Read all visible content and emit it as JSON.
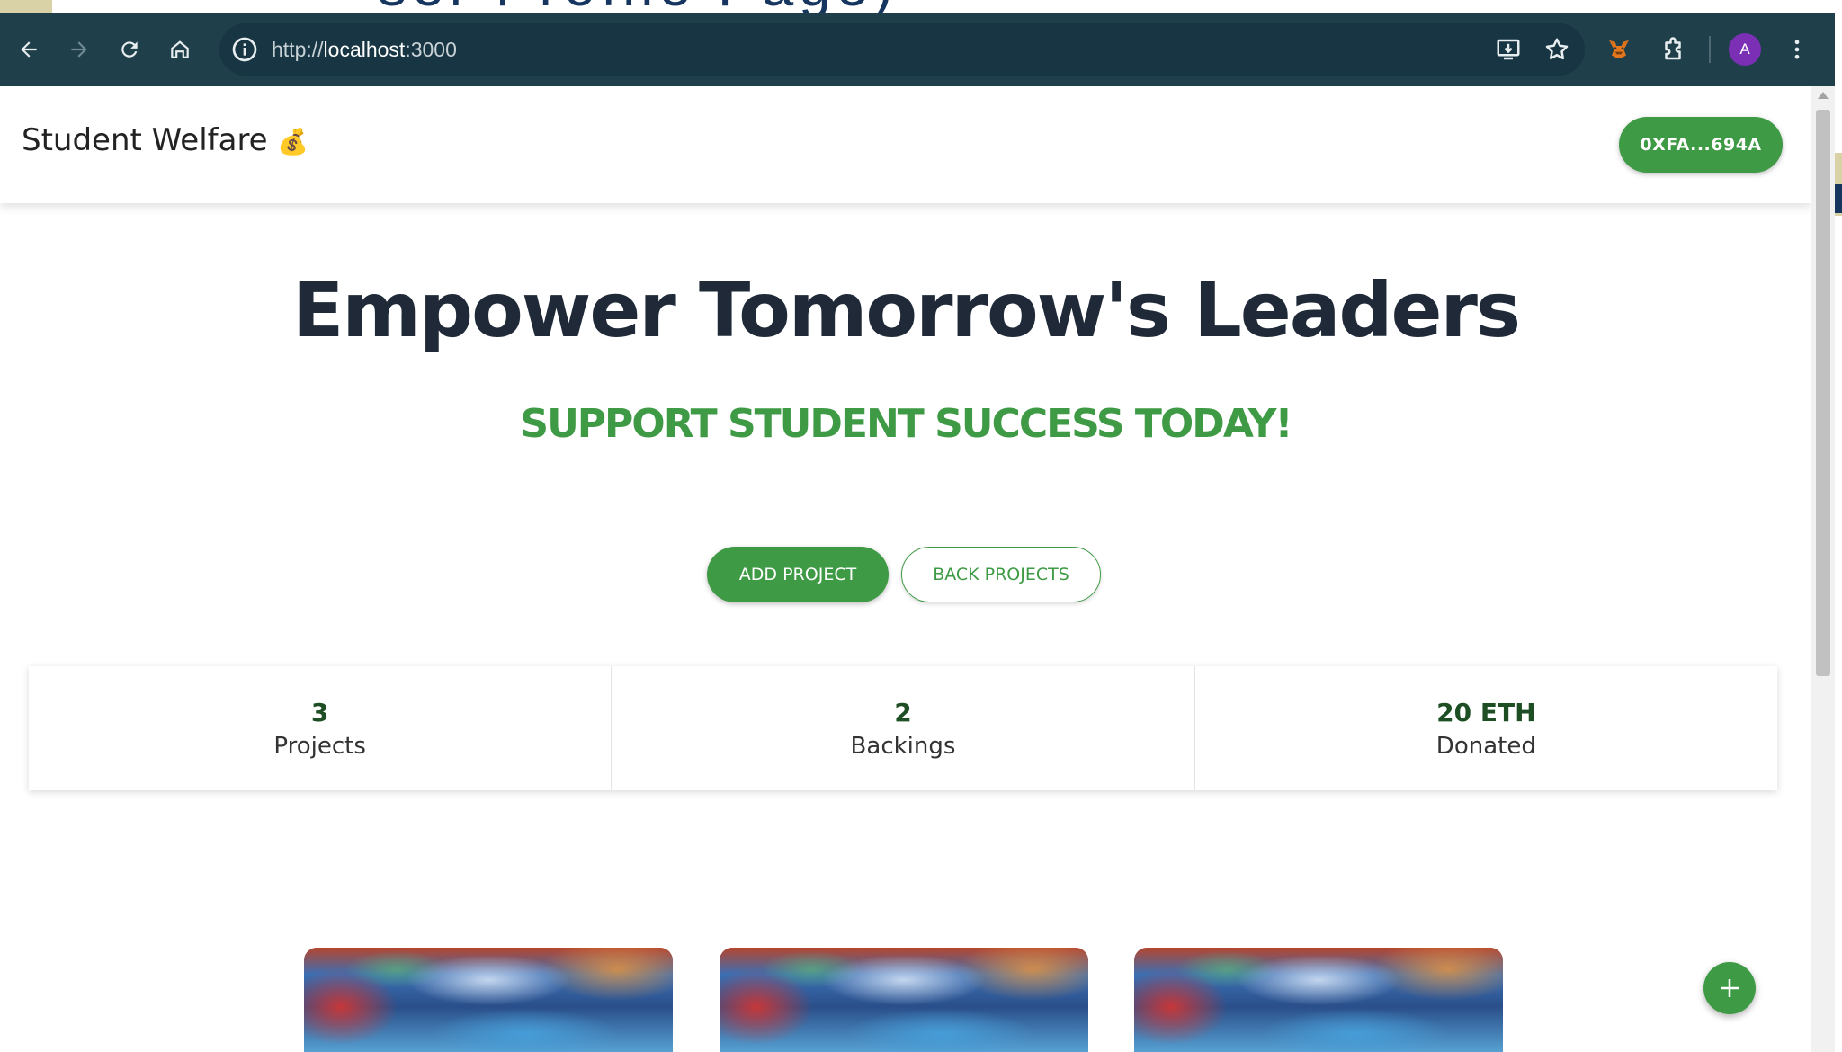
{
  "slide": {
    "title_fragment": "ser Profile Page)"
  },
  "browser": {
    "url_prefix": "http://",
    "url_host": "localhost",
    "url_port": ":3000",
    "avatar_letter": "A",
    "icons": [
      "back-icon",
      "forward-icon",
      "reload-icon",
      "home-icon",
      "site-info-icon",
      "install-app-icon",
      "bookmark-star-icon",
      "metamask-fox-icon",
      "extensions-puzzle-icon",
      "more-vert-icon"
    ]
  },
  "navbar": {
    "brand": "Student Welfare",
    "brand_icon": "💰",
    "wallet_button": "0XFA...694A"
  },
  "hero": {
    "title": "Empower Tomorrow's Leaders",
    "subtitle": "SUPPORT STUDENT SUCCESS TODAY!",
    "add_project_label": "ADD PROJECT",
    "back_projects_label": "BACK PROJECTS"
  },
  "stats": [
    {
      "value": "3",
      "label": "Projects"
    },
    {
      "value": "2",
      "label": "Backings"
    },
    {
      "value": "20 ETH",
      "label": "Donated"
    }
  ],
  "cards": [
    {
      "image": "project-thumbnail"
    },
    {
      "image": "project-thumbnail"
    },
    {
      "image": "project-thumbnail"
    }
  ],
  "colors": {
    "accent": "#3e9a44",
    "toolbar": "#1f3f4a",
    "heading": "#1f2937"
  }
}
